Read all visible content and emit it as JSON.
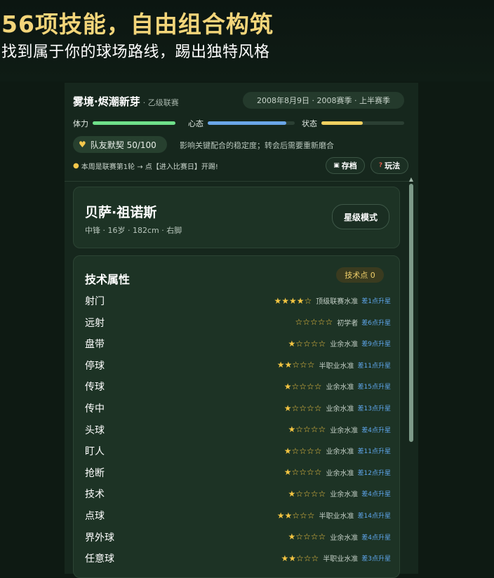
{
  "banner": {
    "headline": "56项技能，自由组合构筑",
    "subline": "找到属于你的球场路线，踢出独特风格"
  },
  "header": {
    "team_name": "雾境·烬潮新芽",
    "league": "· 乙级联赛",
    "date": "2008年8月9日 · 2008赛季 · 上半赛季"
  },
  "bars": [
    {
      "label": "体力",
      "level": 1.0,
      "color": "#6fe08a"
    },
    {
      "label": "心态",
      "level": 0.9,
      "color": "#6aa6e8"
    },
    {
      "label": "状态",
      "level": 0.5,
      "color": "#f0d060"
    }
  ],
  "chemistry": {
    "label": "队友默契 50/100",
    "note": "影响关键配合的稳定度；转会后需要重新磨合",
    "heart_icon": "heart-icon"
  },
  "hint": "本周是联赛第1轮 → 点【进入比赛日】开踢!",
  "buttons": {
    "save": "存档",
    "play": "玩法",
    "star_mode": "星级模式"
  },
  "player": {
    "name": "贝萨·祖诺斯",
    "meta": "中锋 · 16岁 · 182cm · 右脚"
  },
  "attributes": {
    "title": "技术属性",
    "points": "技术点 0",
    "rows": [
      {
        "name": "射门",
        "stars": "★★★★☆",
        "level": "顶级联赛水准",
        "upgrade": "差1点升星"
      },
      {
        "name": "远射",
        "stars": "☆☆☆☆☆",
        "level": "初学者",
        "upgrade": "差6点升星"
      },
      {
        "name": "盘带",
        "stars": "★☆☆☆☆",
        "level": "业余水准",
        "upgrade": "差9点升星"
      },
      {
        "name": "停球",
        "stars": "★★☆☆☆",
        "level": "半职业水准",
        "upgrade": "差11点升星"
      },
      {
        "name": "传球",
        "stars": "★☆☆☆☆",
        "level": "业余水准",
        "upgrade": "差15点升星"
      },
      {
        "name": "传中",
        "stars": "★☆☆☆☆",
        "level": "业余水准",
        "upgrade": "差13点升星"
      },
      {
        "name": "头球",
        "stars": "★☆☆☆☆",
        "level": "业余水准",
        "upgrade": "差4点升星"
      },
      {
        "name": "盯人",
        "stars": "★☆☆☆☆",
        "level": "业余水准",
        "upgrade": "差11点升星"
      },
      {
        "name": "抢断",
        "stars": "★☆☆☆☆",
        "level": "业余水准",
        "upgrade": "差12点升星"
      },
      {
        "name": "技术",
        "stars": "★☆☆☆☆",
        "level": "业余水准",
        "upgrade": "差4点升星"
      },
      {
        "name": "点球",
        "stars": "★★☆☆☆",
        "level": "半职业水准",
        "upgrade": "差14点升星"
      },
      {
        "name": "界外球",
        "stars": "★☆☆☆☆",
        "level": "业余水准",
        "upgrade": "差4点升星"
      },
      {
        "name": "任意球",
        "stars": "★★☆☆☆",
        "level": "半职业水准",
        "upgrade": "差3点升星"
      }
    ]
  }
}
